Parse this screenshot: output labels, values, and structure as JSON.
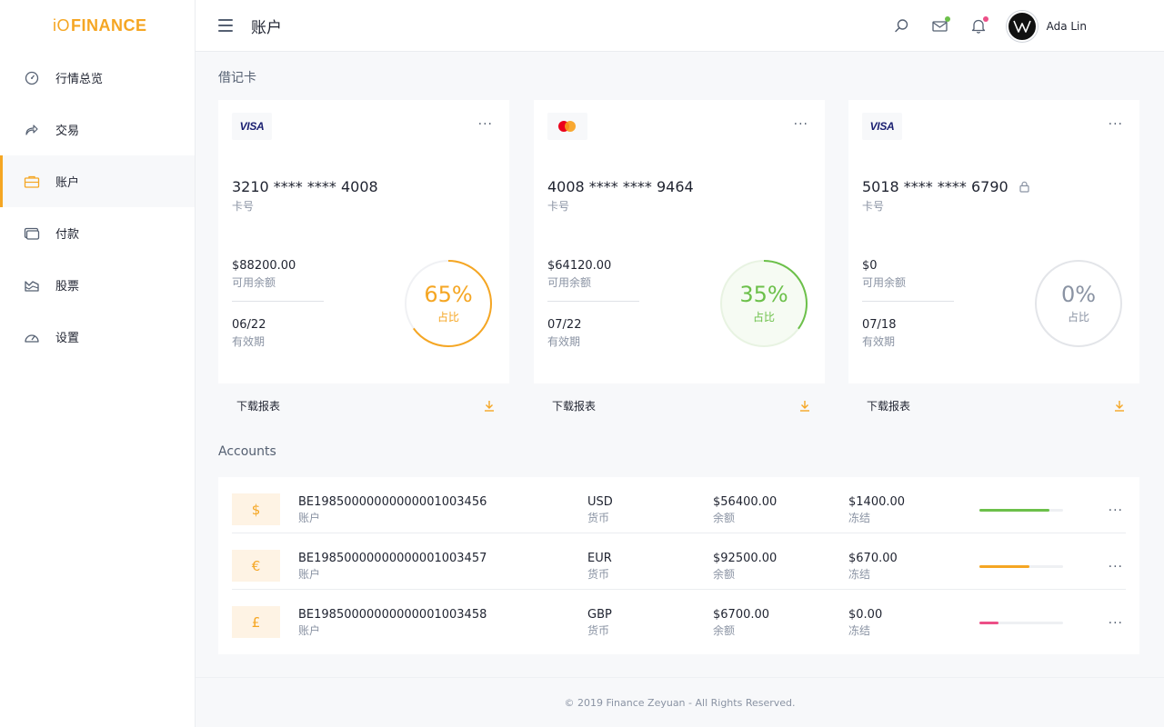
{
  "app": {
    "logo_prefix": "iO",
    "logo_name": "FINANCE"
  },
  "colors": {
    "accent": "#f5a623",
    "green": "#6cc04a",
    "pink": "#ec4f87",
    "gray_ring": "#e3e5e9"
  },
  "sidebar": {
    "items": [
      {
        "label": "行情总览",
        "icon": "dashboard-gauge-icon",
        "active": false
      },
      {
        "label": "交易",
        "icon": "share-arrow-icon",
        "active": false
      },
      {
        "label": "账户",
        "icon": "briefcase-icon",
        "active": true
      },
      {
        "label": "付款",
        "icon": "wallet-icon",
        "active": false
      },
      {
        "label": "股票",
        "icon": "chart-area-icon",
        "active": false
      },
      {
        "label": "设置",
        "icon": "settings-gauge-icon",
        "active": false
      }
    ]
  },
  "header": {
    "title": "账户",
    "icons": [
      "search-icon",
      "mail-icon",
      "bell-icon"
    ],
    "user_name": "Ada Lin"
  },
  "debit": {
    "title": "借记卡",
    "cards": [
      {
        "brand": "VISA",
        "number": "3210 **** **** 4008",
        "number_label": "卡号",
        "balance": "$88200.00",
        "balance_label": "可用余额",
        "expiry": "06/22",
        "expiry_label": "有效期",
        "percent_text": "65%",
        "percent_value": 65,
        "percent_label": "占比",
        "color": "#f5a623",
        "locked": false,
        "footer_label": "下载报表"
      },
      {
        "brand": "mastercard",
        "number": "4008 **** **** 9464",
        "number_label": "卡号",
        "balance": "$64120.00",
        "balance_label": "可用余额",
        "expiry": "07/22",
        "expiry_label": "有效期",
        "percent_text": "35%",
        "percent_value": 35,
        "percent_label": "占比",
        "color": "#6cc04a",
        "locked": false,
        "footer_label": "下载报表"
      },
      {
        "brand": "VISA",
        "number": "5018 **** **** 6790",
        "number_label": "卡号",
        "balance": "$0",
        "balance_label": "可用余额",
        "expiry": "07/18",
        "expiry_label": "有效期",
        "percent_text": "0%",
        "percent_value": 0,
        "percent_label": "占比",
        "color": "#8a93a3",
        "locked": true,
        "footer_label": "下载报表"
      }
    ]
  },
  "accounts": {
    "title": "Accounts",
    "rows": [
      {
        "symbol": "$",
        "iban": "BE19850000000000001003456",
        "iban_label": "账户",
        "currency": "USD",
        "currency_label": "货币",
        "balance": "$56400.00",
        "balance_label": "余额",
        "frozen": "$1400.00",
        "frozen_label": "冻结",
        "progress": 0.84,
        "bar_color": "#6cc04a"
      },
      {
        "symbol": "€",
        "iban": "BE19850000000000001003457",
        "iban_label": "账户",
        "currency": "EUR",
        "currency_label": "货币",
        "balance": "$92500.00",
        "balance_label": "余额",
        "frozen": "$670.00",
        "frozen_label": "冻结",
        "progress": 0.6,
        "bar_color": "#f5a623"
      },
      {
        "symbol": "£",
        "iban": "BE19850000000000001003458",
        "iban_label": "账户",
        "currency": "GBP",
        "currency_label": "货币",
        "balance": "$6700.00",
        "balance_label": "余额",
        "frozen": "$0.00",
        "frozen_label": "冻结",
        "progress": 0.23,
        "bar_color": "#ec4f87"
      }
    ]
  },
  "footer": {
    "copyright": "© 2019 Finance Zeyuan - All Rights Reserved."
  }
}
